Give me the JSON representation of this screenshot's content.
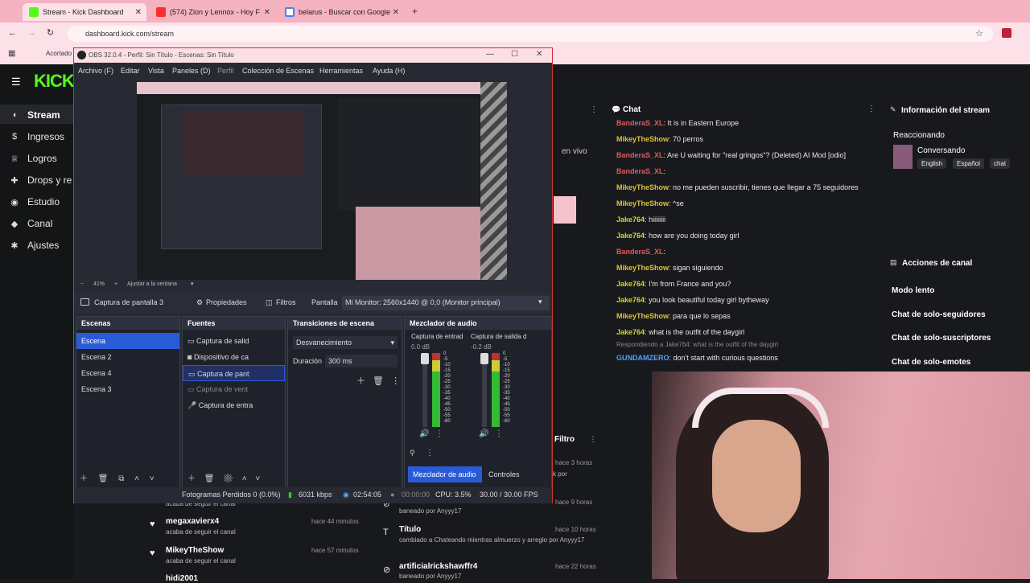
{
  "browser": {
    "tabs": [
      {
        "title": "Stream - Kick Dashboard",
        "color": "#53fc18"
      },
      {
        "title": "(574) Zion y Lennox - Hoy F",
        "color": "#ff2d2d"
      },
      {
        "title": "belarus - Buscar con Google",
        "color": "#4285f4"
      }
    ],
    "url": "dashboard.kick.com/stream",
    "bookmark": "Acortado"
  },
  "kick": {
    "logo": "KICK",
    "nav": [
      {
        "label": "Stream",
        "icon": "stream-icon"
      },
      {
        "label": "Ingresos",
        "icon": "dollar-icon"
      },
      {
        "label": "Logros",
        "icon": "trophy-icon"
      },
      {
        "label": "Drops y re",
        "icon": "gift-icon"
      },
      {
        "label": "Estudio",
        "icon": "studio-icon"
      },
      {
        "label": "Canal",
        "icon": "channel-icon"
      },
      {
        "label": "Ajustes",
        "icon": "gear-icon"
      }
    ],
    "en_vivo": "en vivo",
    "chat": {
      "title": "Chat",
      "messages": [
        {
          "user": "BanderaS_XL",
          "text": "It is in Eastern Europe",
          "color": "#e05a5a"
        },
        {
          "user": "MikeyTheShow",
          "text": "70 perros",
          "color": "#e0c23a"
        },
        {
          "user": "BanderaS_XL",
          "text": "Are U waiting for \"real gringos\"? (Deleted) AI Mod [odio]",
          "color": "#e05a5a"
        },
        {
          "user": "BanderaS_XL",
          "text": "",
          "color": "#e05a5a"
        },
        {
          "user": "MikeyTheShow",
          "text": "no me pueden suscribir, tienes que llegar a 75 seguidores",
          "color": "#e0c23a"
        },
        {
          "user": "MikeyTheShow",
          "text": "^se",
          "color": "#e0c23a"
        },
        {
          "user": "Jake764",
          "text": "hiiiiiiii",
          "color": "#d2d62f"
        },
        {
          "user": "Jake764",
          "text": "how are you doing today girl",
          "color": "#d2d62f"
        },
        {
          "user": "BanderaS_XL",
          "text": "",
          "color": "#e05a5a"
        },
        {
          "user": "MikeyTheShow",
          "text": "sigan siguiendo",
          "color": "#e0c23a"
        },
        {
          "user": "Jake764",
          "text": "I'm from France and you?",
          "color": "#d2d62f"
        },
        {
          "user": "Jake764",
          "text": "you look beautiful today girl bytheway",
          "color": "#d2d62f"
        },
        {
          "user": "MikeyTheShow",
          "text": "para que lo sepas",
          "color": "#e0c23a"
        },
        {
          "user": "Jake764",
          "text": "what is the outfit of the daygirl",
          "color": "#d2d62f"
        },
        {
          "user": "GUNDAMZERO",
          "text": "don't start with curious questions",
          "color": "#4fa3ff"
        }
      ],
      "reply_note": "Respondiendo a Jake764: what is the outfit of the daygirl"
    },
    "stream_info": {
      "title": "Información del stream",
      "category": "Reaccionando",
      "subcategory": "Conversando",
      "tags": [
        "English",
        "Español",
        "chat"
      ]
    },
    "channel_actions": {
      "title": "Acciones de canal",
      "items": [
        "Modo lento",
        "Chat de solo-seguidores",
        "Chat de solo-suscriptores",
        "Chat de solo-emotes"
      ]
    },
    "filter_label": "Filtro",
    "events_left": [
      {
        "text": "acaba de seguir el canal",
        "name": "",
        "time": ""
      },
      {
        "name": "megaxavierx4",
        "text": "acaba de seguir el canal",
        "time": "hace 44 minutos"
      },
      {
        "name": "MikeyTheShow",
        "text": "acaba de seguir el canal",
        "time": "hace 57 minutos"
      },
      {
        "name": "hidi2001",
        "text": "",
        "time": ""
      }
    ],
    "events_right": [
      {
        "name": "baneado por Anyyy17",
        "time": "hace 9 horas"
      },
      {
        "name": "Título",
        "text": "cambiado a Chateando mientras almuerzo y arreglo por Anyyy17",
        "time": "hace 10 horas"
      },
      {
        "name": "artificialrickshawffr4",
        "text": "baneado por Anyyy17",
        "time": "hace 22 horas"
      }
    ],
    "hace_3": "hace 3 horas",
    "k_por": "k por"
  },
  "obs": {
    "title": "OBS 32.0.4 - Perfil: Sin Título - Escenas: Sin Título",
    "menu": [
      "Archivo (F)",
      "Editar",
      "Vista",
      "Paneles (D)",
      "Perfil",
      "Colección de Escenas",
      "Herramientas",
      "Ayuda (H)"
    ],
    "zoom": "41%",
    "fit": "Ajustar a la ventana",
    "source_bar": {
      "name": "Captura de pantalla 3",
      "properties": "Propiedades",
      "filters": "Filtros",
      "screen_label": "Pantalla",
      "screen_value": "Mi Monitor: 2560x1440 @ 0,0 (Monitor principal)"
    },
    "scenes": {
      "title": "Escenas",
      "items": [
        "Escena",
        "Escena 2",
        "Escena 4",
        "Escena 3"
      ]
    },
    "sources": {
      "title": "Fuentes",
      "items": [
        "Captura de salid",
        "Dispositivo de ca",
        "Captura de pant",
        "Captura de vent",
        "Captura de entra"
      ]
    },
    "transitions": {
      "title": "Transiciones de escena",
      "value": "Desvanecimiento",
      "duration_label": "Duración",
      "duration_value": "300 ms"
    },
    "mixer": {
      "title": "Mezclador de audio",
      "channels": [
        {
          "name": "Captura de entrad",
          "db": "0.0 dB"
        },
        {
          "name": "Captura de salida d",
          "db": "-0.2 dB"
        }
      ],
      "scale": [
        "0",
        "-5",
        "-10",
        "-15",
        "-20",
        "-25",
        "-30",
        "-35",
        "-40",
        "-45",
        "-50",
        "-55",
        "-60"
      ],
      "tab_mixer": "Mezclador de audio",
      "tab_controls": "Controles"
    },
    "status": {
      "frames": "Fotogramas Perdidos 0 (0.0%)",
      "kbps": "6031 kbps",
      "live_time": "02:54:05",
      "rec_time": "00:00:00",
      "cpu": "CPU: 3.5%",
      "fps": "30.00 / 30.00 FPS"
    }
  }
}
